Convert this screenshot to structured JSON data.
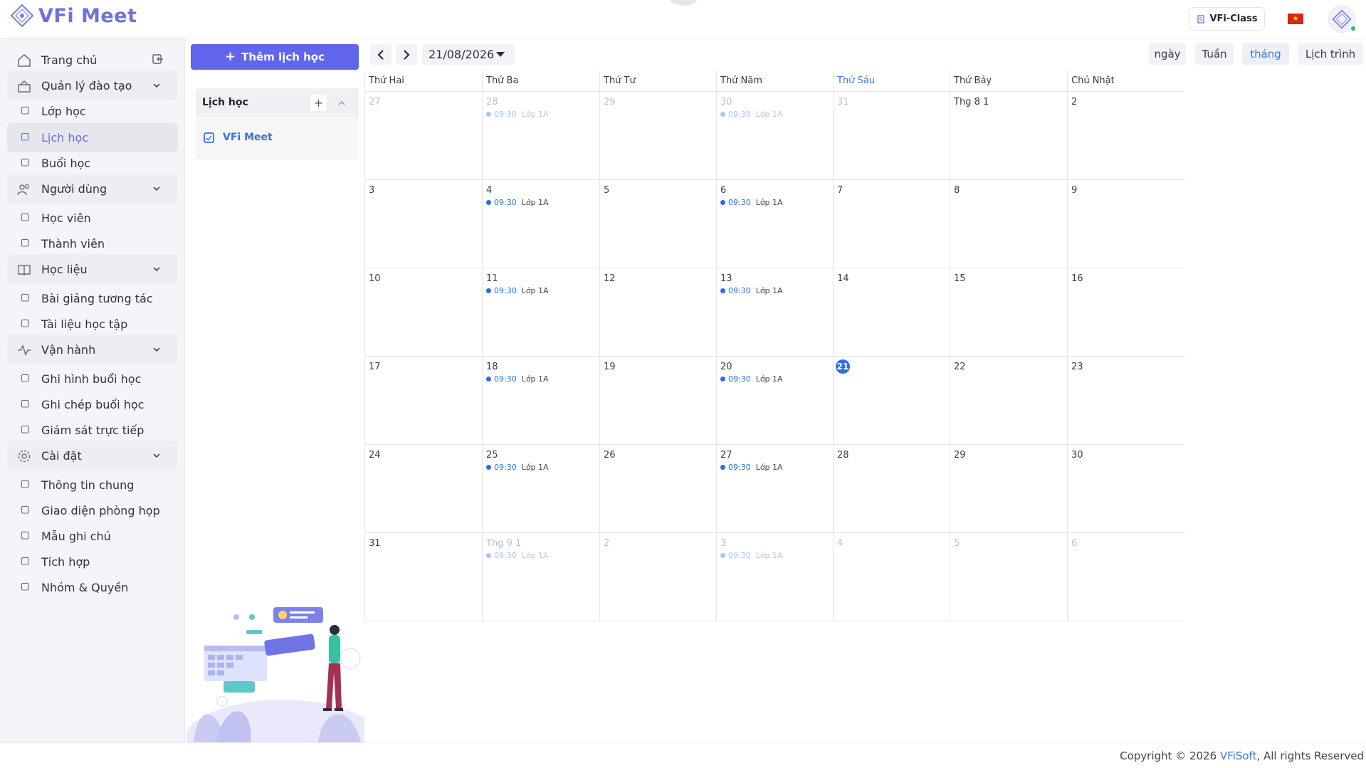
{
  "app": {
    "logo_text": "VFi Meet",
    "class_button": "VFi-Class",
    "language_flag": "vietnam-flag"
  },
  "sidebar": {
    "items": [
      {
        "label": "Trang chủ",
        "icon": "home-icon",
        "type": "item"
      },
      {
        "label": "Quản lý đào tạo",
        "icon": "school-icon",
        "type": "group"
      },
      {
        "label": "Lớp học",
        "icon": "classroom-icon",
        "type": "sub"
      },
      {
        "label": "Lịch học",
        "icon": "calendar-icon",
        "type": "sub",
        "active": true
      },
      {
        "label": "Buổi học",
        "icon": "session-icon",
        "type": "sub"
      },
      {
        "label": "Người dùng",
        "icon": "users-icon",
        "type": "group"
      },
      {
        "label": "Học viên",
        "icon": "student-icon",
        "type": "sub"
      },
      {
        "label": "Thành viên",
        "icon": "member-icon",
        "type": "sub"
      },
      {
        "label": "Học liệu",
        "icon": "book-icon",
        "type": "group"
      },
      {
        "label": "Bài giảng tương tác",
        "icon": "lecture-icon",
        "type": "sub"
      },
      {
        "label": "Tài liệu học tập",
        "icon": "folder-icon",
        "type": "sub"
      },
      {
        "label": "Vận hành",
        "icon": "activity-icon",
        "type": "group"
      },
      {
        "label": "Ghi hình buổi học",
        "icon": "record-icon",
        "type": "sub"
      },
      {
        "label": "Ghi chép buổi học",
        "icon": "note-icon",
        "type": "sub"
      },
      {
        "label": "Giám sát trực tiếp",
        "icon": "monitor-icon",
        "type": "sub"
      },
      {
        "label": "Cài đặt",
        "icon": "settings-icon",
        "type": "group"
      },
      {
        "label": "Thông tin chung",
        "icon": "info-icon",
        "type": "sub"
      },
      {
        "label": "Giao diện phòng họp",
        "icon": "palette-icon",
        "type": "sub"
      },
      {
        "label": "Mẫu ghi chú",
        "icon": "template-icon",
        "type": "sub"
      },
      {
        "label": "Tích hợp",
        "icon": "integration-icon",
        "type": "sub"
      },
      {
        "label": "Nhóm & Quyền",
        "icon": "permission-icon",
        "type": "sub"
      }
    ]
  },
  "left_panel": {
    "add_button": "Thêm lịch học",
    "calendars_title": "Lịch học",
    "calendars": [
      {
        "label": "VFi Meet",
        "checked": true
      }
    ]
  },
  "toolbar": {
    "current_date": "21/08/2026",
    "views": [
      {
        "label": "ngày",
        "active": false
      },
      {
        "label": "Tuần",
        "active": false
      },
      {
        "label": "tháng",
        "active": true
      },
      {
        "label": "Lịch trình",
        "active": false
      }
    ]
  },
  "calendar": {
    "weekdays": [
      "Thứ Hai",
      "Thứ Ba",
      "Thứ Tư",
      "Thứ Năm",
      "Thứ Sáu",
      "Thứ Bảy",
      "Chủ Nhật"
    ],
    "today_col": 4,
    "weeks": [
      [
        {
          "d": "27",
          "m": true
        },
        {
          "d": "28",
          "m": true,
          "ev": true
        },
        {
          "d": "29",
          "m": true
        },
        {
          "d": "30",
          "m": true,
          "ev": true
        },
        {
          "d": "31",
          "m": true
        },
        {
          "d": "Thg 8 1"
        },
        {
          "d": "2"
        }
      ],
      [
        {
          "d": "3"
        },
        {
          "d": "4",
          "ev": true
        },
        {
          "d": "5"
        },
        {
          "d": "6",
          "ev": true
        },
        {
          "d": "7"
        },
        {
          "d": "8"
        },
        {
          "d": "9"
        }
      ],
      [
        {
          "d": "10"
        },
        {
          "d": "11",
          "ev": true
        },
        {
          "d": "12"
        },
        {
          "d": "13",
          "ev": true
        },
        {
          "d": "14"
        },
        {
          "d": "15"
        },
        {
          "d": "16"
        }
      ],
      [
        {
          "d": "17"
        },
        {
          "d": "18",
          "ev": true
        },
        {
          "d": "19"
        },
        {
          "d": "20",
          "ev": true
        },
        {
          "d": "21",
          "today": true
        },
        {
          "d": "22"
        },
        {
          "d": "23"
        }
      ],
      [
        {
          "d": "24"
        },
        {
          "d": "25",
          "ev": true
        },
        {
          "d": "26"
        },
        {
          "d": "27",
          "ev": true
        },
        {
          "d": "28"
        },
        {
          "d": "29"
        },
        {
          "d": "30"
        }
      ],
      [
        {
          "d": "31"
        },
        {
          "d": "Thg 9 1",
          "m": true,
          "ev": true
        },
        {
          "d": "2",
          "m": true
        },
        {
          "d": "3",
          "m": true,
          "ev": true
        },
        {
          "d": "4",
          "m": true
        },
        {
          "d": "5",
          "m": true
        },
        {
          "d": "6",
          "m": true
        }
      ]
    ],
    "event": {
      "time": "09:30",
      "name": "Lớp 1A"
    }
  },
  "footer": {
    "prefix": "Copyright © 2026 ",
    "brand": "VFiSoft",
    "suffix": ", All rights Reserved"
  },
  "colors": {
    "accent": "#6165ec",
    "event": "#2771e0",
    "today_header": "#3a7bd5"
  }
}
